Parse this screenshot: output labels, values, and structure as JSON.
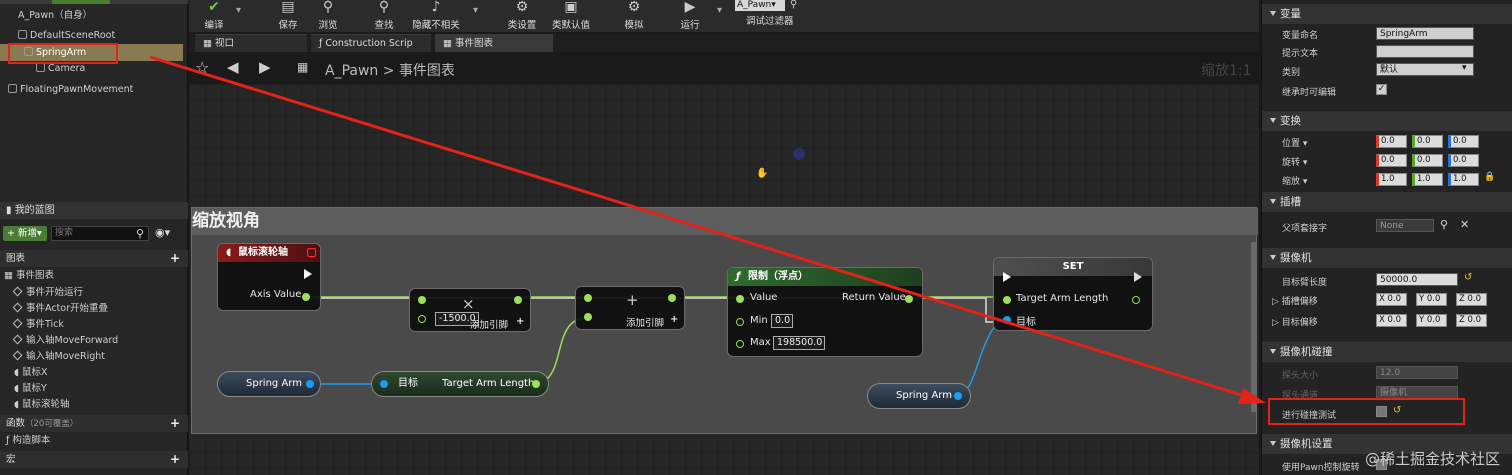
{
  "components": {
    "root_label": "A_Pawn（自身）",
    "items": [
      "DefaultSceneRoot",
      "SpringArm",
      "Camera",
      "FloatingPawnMovement"
    ]
  },
  "my_blueprint": {
    "title": "我的蓝图",
    "add_new": "+ 新增▾",
    "search_placeholder": "搜索",
    "graphs_section": "图表",
    "event_graph": "事件图表",
    "events": [
      "事件开始运行",
      "事件Actor开始重叠",
      "事件Tick",
      "输入轴MoveForward",
      "输入轴MoveRight",
      "鼠标X",
      "鼠标Y",
      "鼠标滚轮轴"
    ],
    "functions_section": "函数",
    "functions_override": "（20可覆盖）",
    "construction_script": "构造脚本",
    "macros_section": "宏"
  },
  "toolbar": {
    "buttons": [
      "编译",
      "保存",
      "浏览",
      "查找",
      "隐藏不相关",
      "类设置",
      "类默认值",
      "模拟",
      "运行"
    ],
    "debug_target": "A_Pawn▾",
    "debug_filter": "调试过滤器"
  },
  "tabs": [
    "视口",
    "Construction Scrip",
    "事件图表"
  ],
  "breadcrumb": {
    "root": "A_Pawn",
    "separator": ">",
    "current": "事件图表",
    "zoom": "缩放1:1"
  },
  "graph": {
    "comment_title": "缩放视角",
    "nodes": {
      "mouse_wheel": {
        "title": "鼠标滚轮轴",
        "axis_value": "Axis Value"
      },
      "multiply": {
        "symbol": "×",
        "value": "-1500.0",
        "add_pin": "添加引脚"
      },
      "add": {
        "symbol": "+",
        "add_pin": "添加引脚"
      },
      "clamp": {
        "title": "限制（浮点）",
        "value": "Value",
        "return_value": "Return Value",
        "min_label": "Min",
        "min_value": "0.0",
        "max_label": "Max",
        "max_value": "198500.0"
      },
      "set": {
        "title": "SET",
        "target_arm_length": "Target Arm Length",
        "target": "目标"
      },
      "spring_arm_1": "Spring Arm",
      "getter": {
        "target": "目标",
        "target_arm_length": "Target Arm Length"
      },
      "spring_arm_2": "Spring Arm"
    }
  },
  "details": {
    "variable_section": "变量",
    "var_name_label": "变量命名",
    "var_name_value": "SpringArm",
    "tooltip_label": "提示文本",
    "category_label": "类别",
    "category_value": "默认",
    "editable_label": "继承时可编辑",
    "transform_section": "变换",
    "location_label": "位置 ▾",
    "rotation_label": "旋转 ▾",
    "scale_label": "缩放 ▾",
    "location": [
      "0.0",
      "0.0",
      "0.0"
    ],
    "rotation": [
      "0.0",
      "0.0",
      "0.0"
    ],
    "scale": [
      "1.0",
      "1.0",
      "1.0"
    ],
    "sockets_section": "插槽",
    "parent_socket_label": "父项套接字",
    "parent_socket_value": "None",
    "camera_section": "摄像机",
    "arm_length_label": "目标臂长度",
    "arm_length_value": "50000.0",
    "socket_offset_label": "插槽偏移",
    "target_offset_label": "目标偏移",
    "socket_offset": [
      "X 0.0",
      "Y 0.0",
      "Z 0.0"
    ],
    "target_offset": [
      "X 0.0",
      "Y 0.0",
      "Z 0.0"
    ],
    "collision_section": "摄像机碰撞",
    "probe_size_label": "探头大小",
    "probe_size_value": "12.0",
    "probe_channel_label": "探头通道",
    "probe_channel_value": "摄像机",
    "collision_test_label": "进行碰撞测试",
    "camera_settings_section": "摄像机设置",
    "use_pawn_rotation_label": "使用Pawn控制旋转"
  },
  "watermark": "@稀土掘金技术社区"
}
